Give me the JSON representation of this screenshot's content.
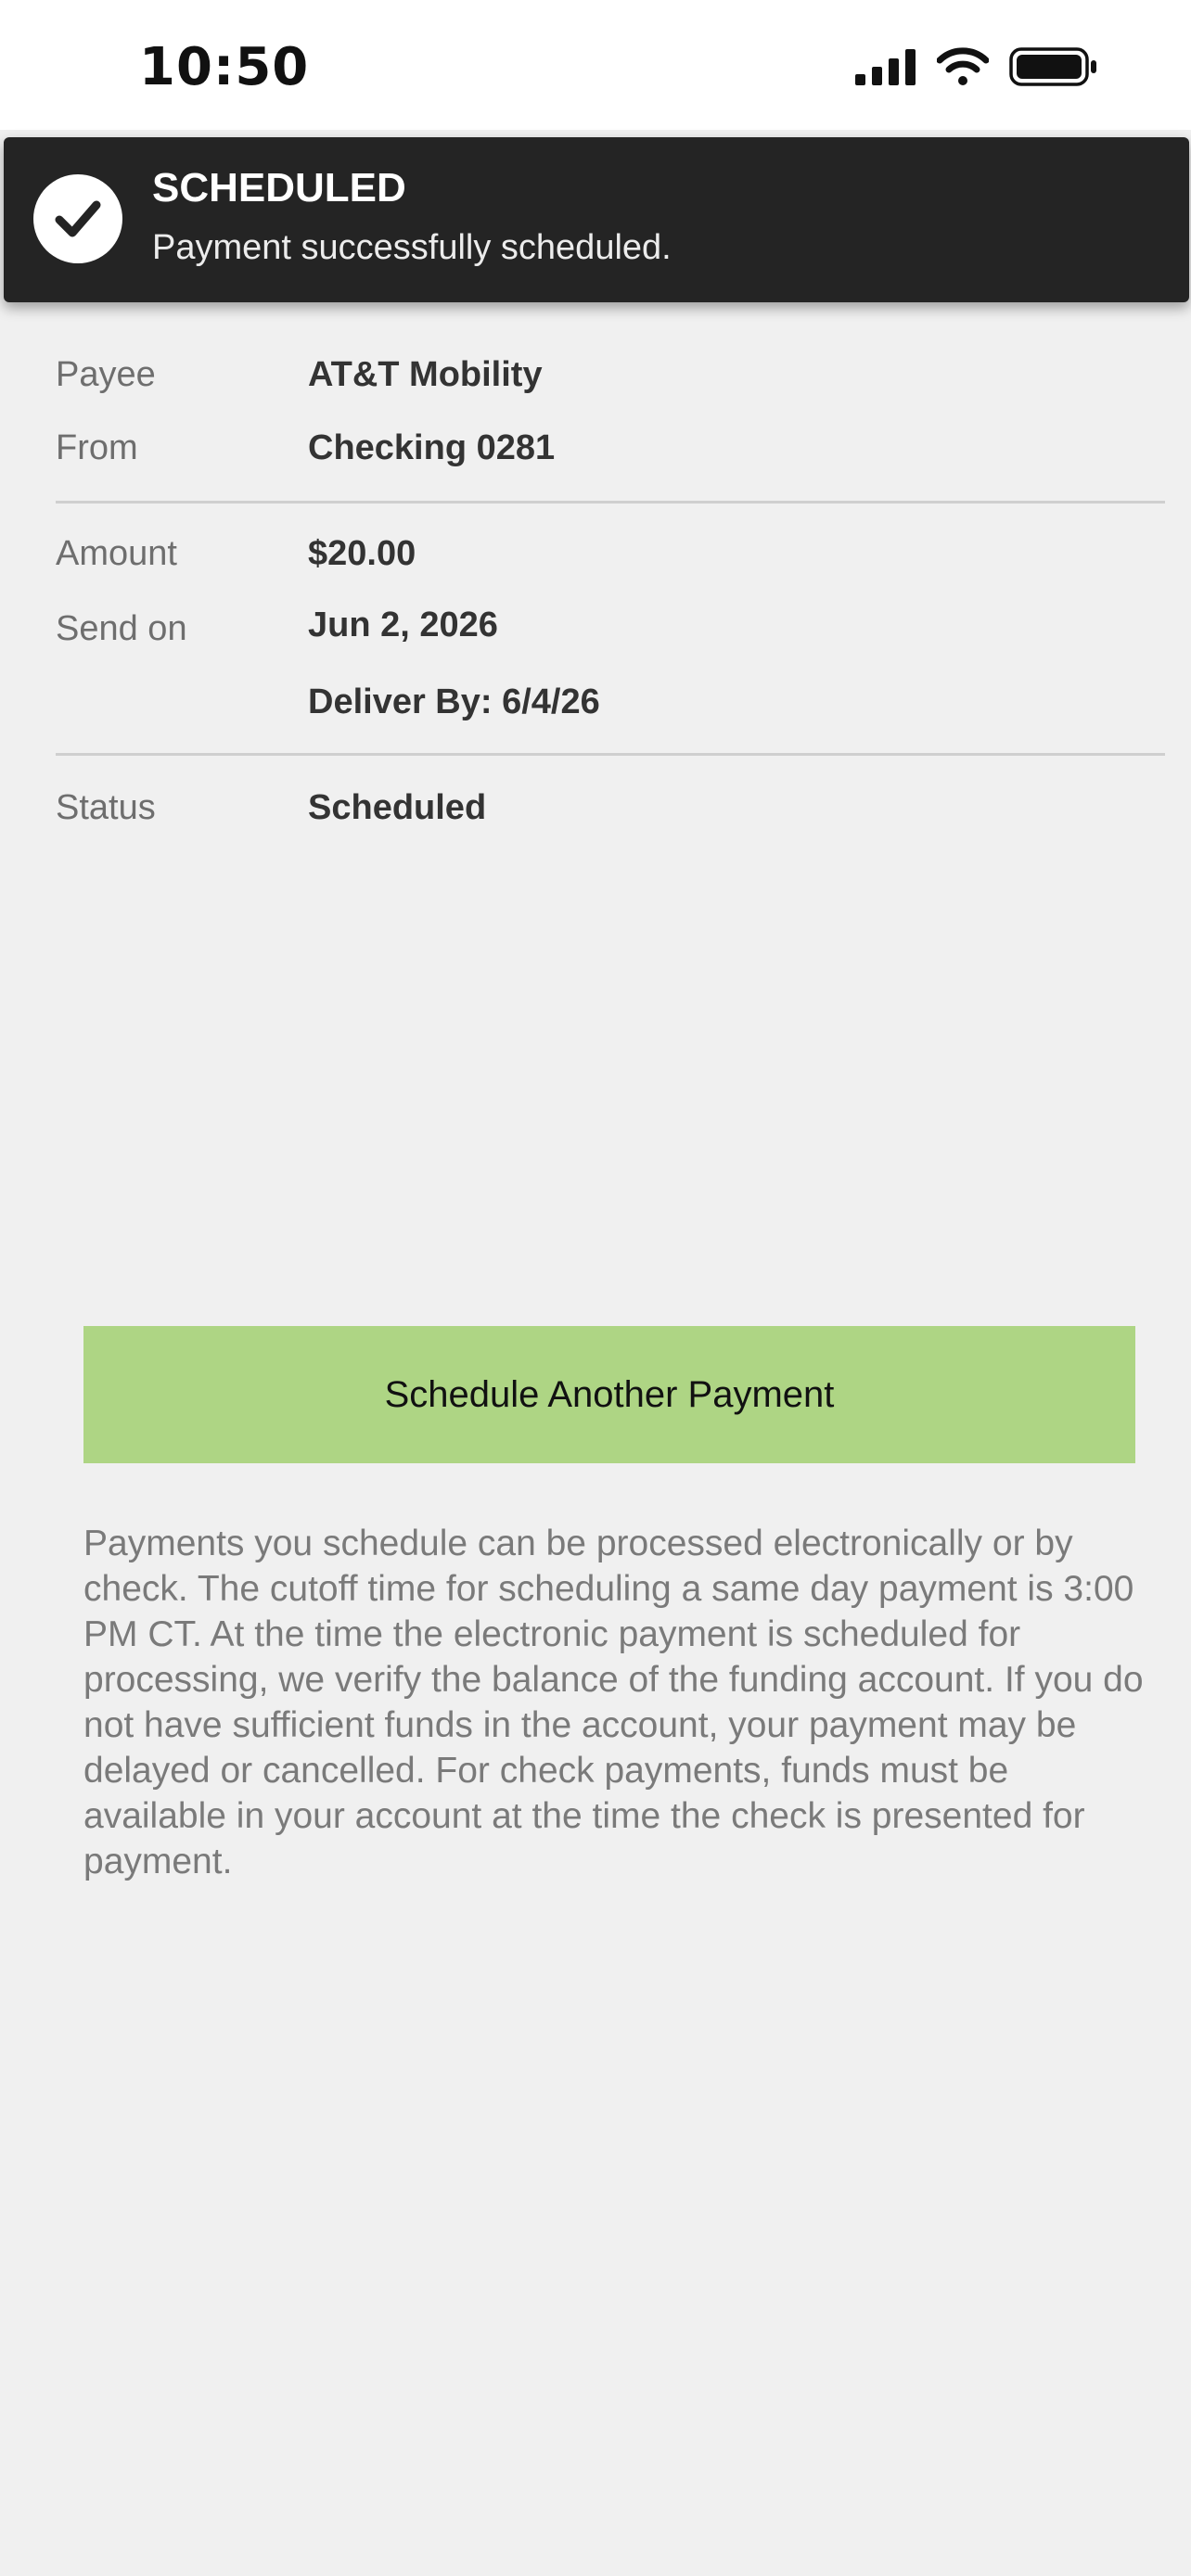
{
  "status_bar": {
    "time": "10:50",
    "icons": [
      "cellular-signal-icon",
      "wifi-icon",
      "battery-icon"
    ]
  },
  "toast": {
    "title": "SCHEDULED",
    "message": "Payment successfully scheduled.",
    "icon": "check-circle-icon"
  },
  "details": {
    "payee_label": "Payee",
    "payee_value": "AT&T Mobility",
    "from_label": "From",
    "from_value": "Checking 0281",
    "amount_label": "Amount",
    "amount_value": "$20.00",
    "send_on_label": "Send on",
    "send_on_value": "Jun 2, 2026",
    "deliver_by_label": "Deliver By:",
    "deliver_by_value": "6/4/26",
    "status_label": "Status",
    "status_value": "Scheduled"
  },
  "actions": {
    "schedule_another_label": "Schedule Another Payment"
  },
  "disclaimer": "Payments you schedule can be processed electronically or by check. The cutoff time for scheduling a same day payment is 3:00 PM CT. At the time the electronic payment is scheduled for processing, we verify the balance of the funding account. If you do not have sufficient funds in the account, your payment may be delayed or cancelled. For check payments, funds must be available in your account at the time the check is presented for payment.",
  "colors": {
    "toast_background": "#242424",
    "button_background": "#aed584",
    "page_background": "#f0f0f0"
  }
}
